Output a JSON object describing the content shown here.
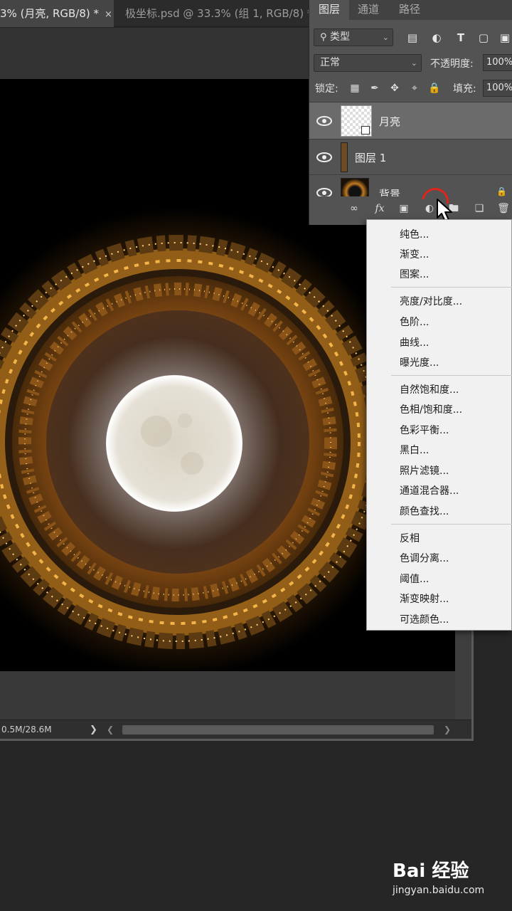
{
  "document_tabs": [
    {
      "label": "3% (月亮, RGB/8) *",
      "close": "×"
    },
    {
      "label": "极坐标.psd @ 33.3% (组 1, RGB/8) *"
    }
  ],
  "layers_panel": {
    "tabs": [
      "图层",
      "通道",
      "路径"
    ],
    "filter_select": "类型",
    "blend_mode": "正常",
    "opacity_label": "不透明度:",
    "opacity_value": "100%",
    "lock_label": "锁定:",
    "fill_label": "填充:",
    "fill_value": "100%",
    "layers": [
      {
        "name": "月亮",
        "selected": true
      },
      {
        "name": "图层 1",
        "selected": false
      },
      {
        "name": "背景",
        "selected": false,
        "locked": true
      }
    ],
    "footer_fx": "fx"
  },
  "status": {
    "doc_size": "0.5M/28.6M",
    "arrow": "❯"
  },
  "adjustment_menu": {
    "groups": [
      [
        "纯色...",
        "渐变...",
        "图案..."
      ],
      [
        "亮度/对比度...",
        "色阶...",
        "曲线...",
        "曝光度..."
      ],
      [
        "自然饱和度...",
        "色相/饱和度...",
        "色彩平衡...",
        "黑白...",
        "照片滤镜...",
        "通道混合器...",
        "颜色查找..."
      ],
      [
        "反相",
        "色调分离...",
        "阈值...",
        "渐变映射...",
        "可选颜色..."
      ]
    ]
  },
  "watermark": {
    "brand": "Bai 经验",
    "url": "jingyan.baidu.com"
  },
  "colors": {
    "ui_dark": "#262626",
    "panel": "#535353",
    "menu_bg": "#f1f1f1",
    "highlight_circle": "#e0241b"
  }
}
